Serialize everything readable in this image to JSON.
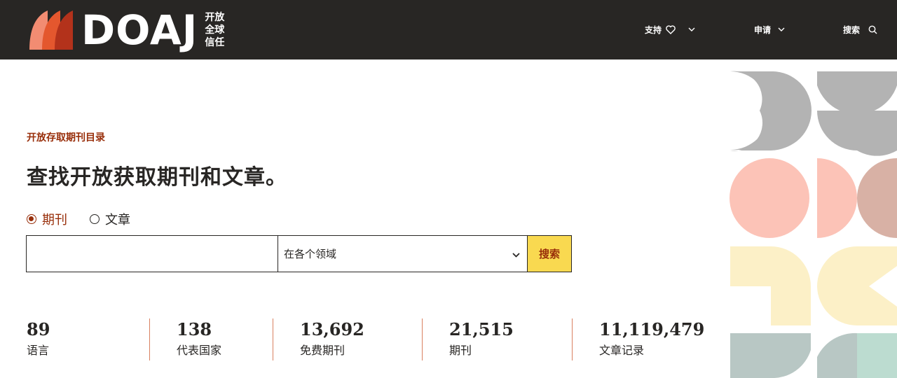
{
  "header": {
    "logo_text": "DOAJ",
    "logo_tagline": [
      "开放",
      "全球",
      "信任"
    ],
    "nav": {
      "support_label": "支持",
      "apply_label": "申请",
      "search_label": "搜索"
    }
  },
  "main": {
    "eyebrow": "开放存取期刊目录",
    "headline": "查找开放获取期刊和文章。",
    "search_type": {
      "options": [
        "期刊",
        "文章"
      ],
      "selected": "期刊"
    },
    "search": {
      "input_value": "",
      "field_select": "在各个领域",
      "button_label": "搜索"
    },
    "stats": [
      {
        "value": "89",
        "label": "语言"
      },
      {
        "value": "138",
        "label": "代表国家"
      },
      {
        "value": "13,692",
        "label": "免费期刊"
      },
      {
        "value": "21,515",
        "label": "期刊"
      },
      {
        "value": "11,119,479",
        "label": "文章记录"
      }
    ]
  },
  "colors": {
    "header_bg": "#282624",
    "accent": "#982e0a",
    "search_button": "#f9d950",
    "divider": "#d9805f"
  },
  "icons": {
    "support": "heart-icon",
    "dropdown": "chevron-down-icon",
    "search": "search-icon"
  }
}
